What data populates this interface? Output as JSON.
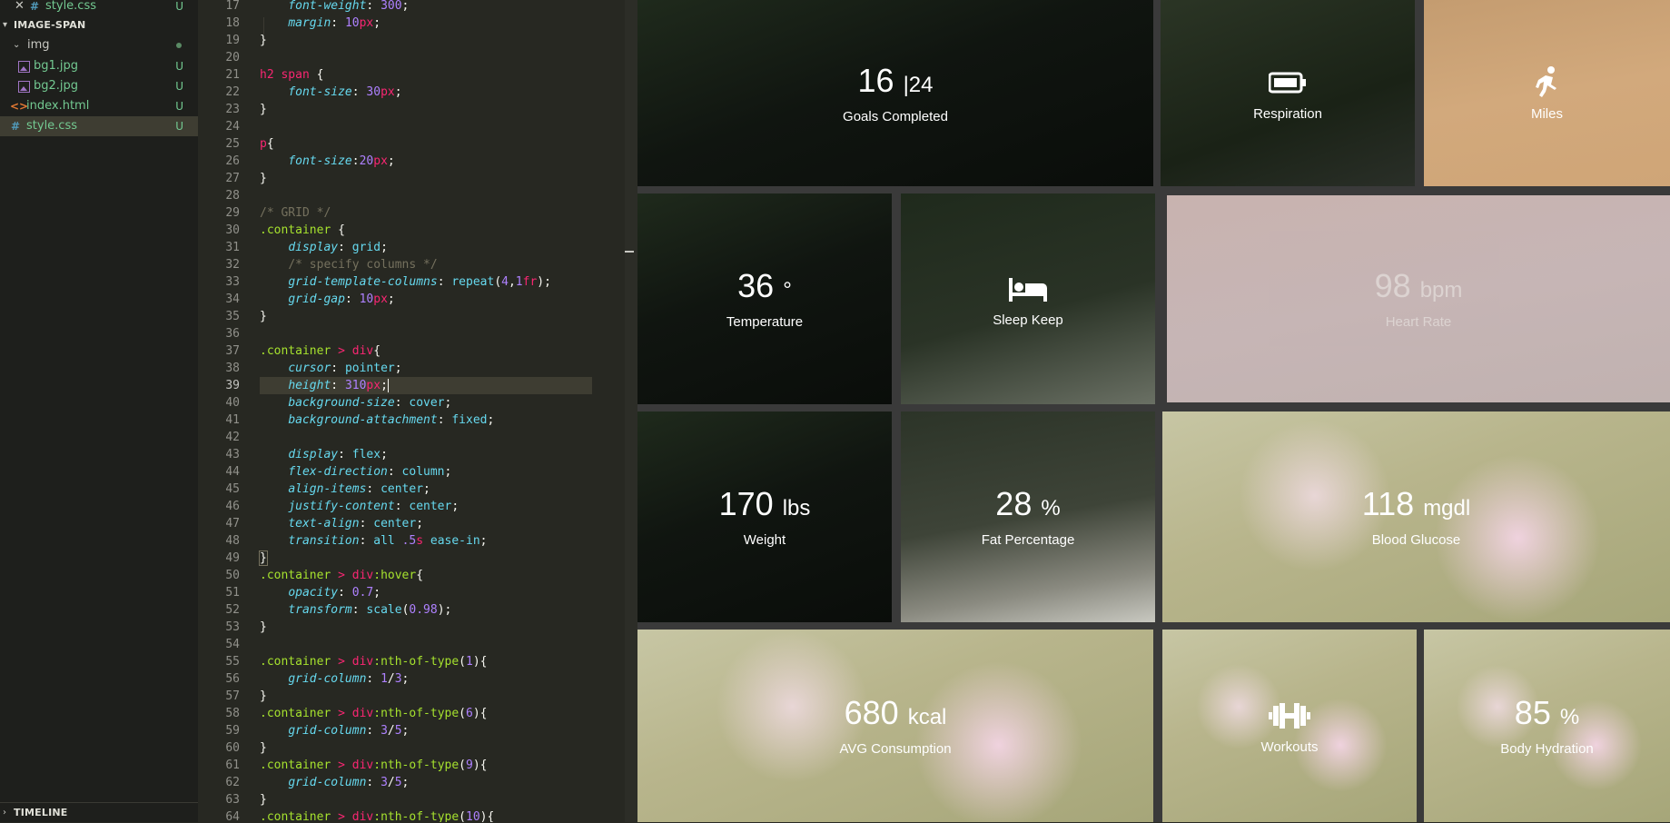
{
  "explorer": {
    "open_editor": {
      "label": "style.css",
      "badge": "U"
    },
    "section_title": "IMAGE-SPAN",
    "folder": {
      "label": "img"
    },
    "files": [
      {
        "label": "bg1.jpg",
        "badge": "U",
        "icon": "image-file-icon"
      },
      {
        "label": "bg2.jpg",
        "badge": "U",
        "icon": "image-file-icon"
      },
      {
        "label": "index.html",
        "badge": "U",
        "icon": "html-file-icon"
      },
      {
        "label": "style.css",
        "badge": "U",
        "icon": "css-file-icon"
      }
    ],
    "timeline": "TIMELINE"
  },
  "editor": {
    "line_numbers": [
      "17",
      "18",
      "19",
      "20",
      "21",
      "22",
      "23",
      "24",
      "25",
      "26",
      "27",
      "28",
      "29",
      "30",
      "31",
      "32",
      "33",
      "34",
      "35",
      "36",
      "37",
      "38",
      "39",
      "40",
      "41",
      "42",
      "43",
      "44",
      "45",
      "46",
      "47",
      "48",
      "49",
      "50",
      "51",
      "52",
      "53",
      "54",
      "55",
      "56",
      "57",
      "58",
      "59",
      "60",
      "61",
      "62",
      "63",
      "64"
    ],
    "current_line": "39"
  },
  "preview": {
    "tiles": [
      {
        "value": "16",
        "sep": "|",
        "sub": "24",
        "label": "Goals Completed"
      },
      {
        "icon": "battery-icon",
        "label": "Respiration"
      },
      {
        "icon": "running-icon",
        "label": "Miles"
      },
      {
        "value": "36",
        "unit": "°",
        "label": "Temperature"
      },
      {
        "icon": "bed-icon",
        "label": "Sleep Keep"
      },
      {
        "value": "98",
        "unit": "bpm",
        "label": "Heart Rate"
      },
      {
        "value": "170",
        "unit": "lbs",
        "label": "Weight"
      },
      {
        "value": "28",
        "unit": "%",
        "label": "Fat Percentage"
      },
      {
        "value": "118",
        "unit": "mgdl",
        "label": "Blood Glucose"
      },
      {
        "value": "680",
        "unit": "kcal",
        "label": "AVG Consumption"
      },
      {
        "icon": "dumbbell-icon",
        "label": "Workouts"
      },
      {
        "value": "85",
        "unit": "%",
        "label": "Body Hydration"
      }
    ]
  },
  "colors": {
    "accent_untracked": "#73c991",
    "editor_bg": "#272822",
    "sidebar_bg": "#1e1f1c"
  }
}
